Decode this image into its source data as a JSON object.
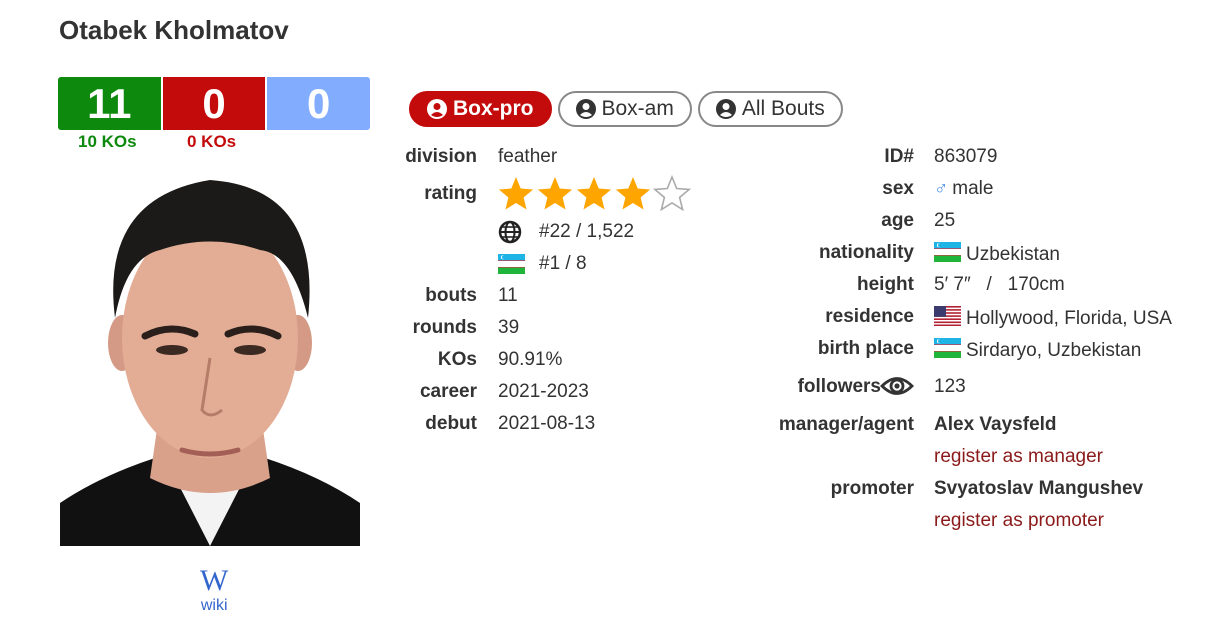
{
  "fighter": {
    "name": "Otabek Kholmatov"
  },
  "record": {
    "wins": "11",
    "losses": "0",
    "draws": "0",
    "wins_kos": "10 KOs",
    "losses_kos": "0 KOs"
  },
  "wiki": {
    "icon": "wikipedia-icon",
    "label": "wiki"
  },
  "tabs": [
    {
      "label": "Box-pro",
      "active": true,
      "icon": "user-circle-icon"
    },
    {
      "label": "Box-am",
      "active": false,
      "icon": "user-circle-icon"
    },
    {
      "label": "All Bouts",
      "active": false,
      "icon": "user-circle-icon"
    }
  ],
  "stats": {
    "division_label": "division",
    "division": "feather",
    "rating_label": "rating",
    "rating_stars": 4,
    "rating_max": 5,
    "world_rank": "#22 / 1,522",
    "country_rank": "#1 / 8",
    "bouts_label": "bouts",
    "bouts": "11",
    "rounds_label": "rounds",
    "rounds": "39",
    "kos_label": "KOs",
    "kos": "90.91%",
    "career_label": "career",
    "career": "2021-2023",
    "debut_label": "debut",
    "debut": "2021-08-13"
  },
  "bio": {
    "id_label": "ID#",
    "id": "863079",
    "sex_label": "sex",
    "sex": "male",
    "age_label": "age",
    "age": "25",
    "nationality_label": "nationality",
    "nationality": "Uzbekistan",
    "height_label": "height",
    "height": "5′ 7″   /   170cm",
    "residence_label": "residence",
    "residence": "Hollywood, Florida, USA",
    "birth_place_label": "birth place",
    "birth_place": "Sirdaryo, Uzbekistan",
    "followers_label": "followers",
    "followers": "123",
    "manager_label": "manager/agent",
    "manager": "Alex Vaysfeld",
    "register_manager": "register as manager",
    "promoter_label": "promoter",
    "promoter": "Svyatoslav Mangushev",
    "register_promoter": "register as promoter"
  },
  "colors": {
    "win": "#0d8a0d",
    "loss": "#c30b0b",
    "draw": "#82adfe",
    "star": "#ffa500",
    "link": "#8b1a1a"
  }
}
